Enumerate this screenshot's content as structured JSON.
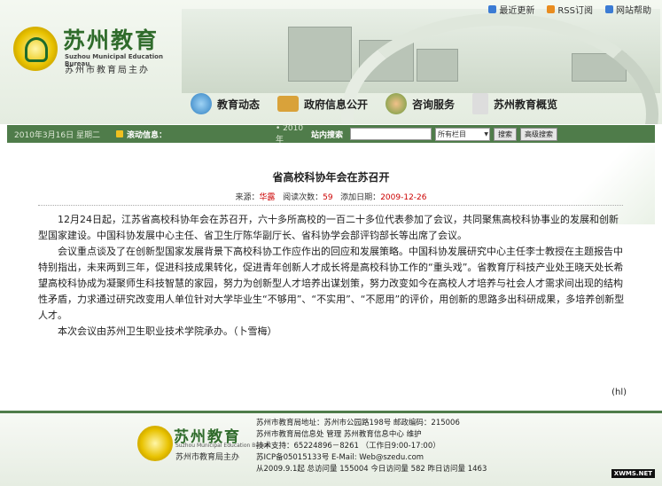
{
  "top_links": [
    {
      "label": "最近更新",
      "icon": "update-icon",
      "color": "#3b7bd4"
    },
    {
      "label": "RSS订阅",
      "icon": "rss-icon",
      "color": "#e98c1f"
    },
    {
      "label": "网站帮助",
      "icon": "help-icon",
      "color": "#3b7bd4"
    }
  ],
  "logo": {
    "title": "苏州教育",
    "english": "Suzhou Municipal Education Bureau",
    "subtitle": "苏州市教育局主办"
  },
  "nav": [
    {
      "label": "教育动态",
      "icon": "globe-icon",
      "color": "#2f7fc1"
    },
    {
      "label": "政府信息公开",
      "icon": "folder-icon",
      "color": "#d9a23a"
    },
    {
      "label": "咨询服务",
      "icon": "people-icon",
      "color": "#6b9b3e"
    },
    {
      "label": "苏州教育概览",
      "icon": "document-icon",
      "color": "#bbbbbb"
    }
  ],
  "search_bar": {
    "date": "2010年3月16日 星期二",
    "info_label": "滚动信息：",
    "year": "• 2010年",
    "search_label": "站内搜索",
    "select_value": "所有栏目",
    "search_button": "搜索",
    "advanced_button": "高级搜索"
  },
  "article": {
    "title": "省高校科协年会在苏召开",
    "meta": {
      "source_label": "来源：",
      "source": "华露",
      "views_label": "阅读次数：",
      "views": "59",
      "date_label": "添加日期：",
      "date": "2009-12-26"
    },
    "paragraphs": [
      "12月24日起，江苏省高校科协年会在苏召开，六十多所高校的一百二十多位代表参加了会议，共同聚焦高校科协事业的发展和创新型国家建设。中国科协发展中心主任、省卫生厅陈华副厅长、省科协学会部评钧部长等出席了会议。",
      "会议重点谈及了在创新型国家发展背景下高校科协工作应作出的回应和发展策略。中国科协发展研究中心主任李士教授在主题报告中特别指出，未来两到三年，促进科技成果转化，促进青年创新人才成长将是高校科协工作的“重头戏”。省教育厅科技产业处王晓天处长希望高校科协成为凝聚师生科技智慧的家园，努力为创新型人才培养出谋划策，努力改变如今在高校人才培养与社会人才需求间出现的结构性矛盾，力求通过研究改变用人单位针对大学毕业生“不够用”、“不实用”、“不愿用”的评价，用创新的思路多出科研成果，多培养创新型人才。",
      "本次会议由苏州卫生职业技术学院承办。（卜雪梅）"
    ],
    "editor_tag": "(hl)"
  },
  "footer": {
    "logo_title": "苏州教育",
    "logo_english": "Suzhou Municipal Education Bureau",
    "logo_subtitle": "苏州市教育局主办",
    "lines": [
      "苏州市教育局地址：苏州市公园路198号 邮政编码：215006",
      "苏州市教育局信息处 管理 苏州教育信息中心 维护",
      "技术支持：65224896－8261 （工作日9:00-17:00）",
      "苏ICP备05015133号 E-Mail: Web@szedu.com",
      "从2009.9.1起 总访问量 155004 今日访问量 582 昨日访问量 1463"
    ],
    "watermark": "XWMS.NET"
  }
}
